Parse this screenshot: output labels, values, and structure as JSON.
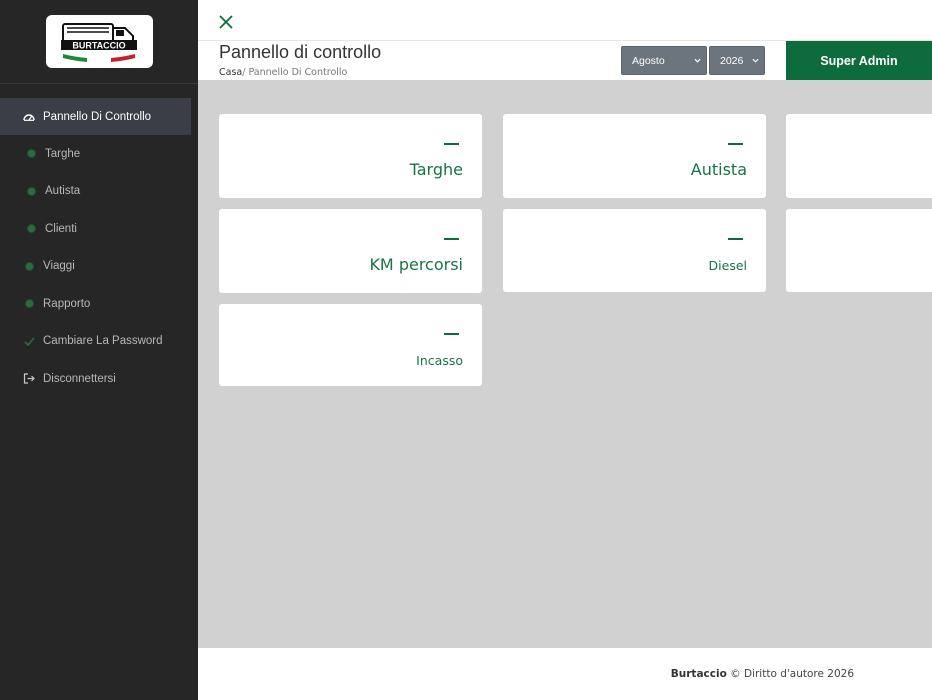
{
  "brand": {
    "logo_text": "BURTACCIO"
  },
  "sidebar": {
    "items": [
      {
        "label": "Pannello Di Controllo",
        "icon": "dashboard-icon",
        "active": true
      },
      {
        "label": "Targhe",
        "icon": "dot-icon"
      },
      {
        "label": "Autista",
        "icon": "dot-icon"
      },
      {
        "label": "Clienti",
        "icon": "dot-icon"
      },
      {
        "label": "Viaggi",
        "icon": "dot-icon"
      },
      {
        "label": "Rapporto",
        "icon": "dot-icon"
      },
      {
        "label": "Cambiare La Password",
        "icon": "check-icon"
      },
      {
        "label": "Disconnettersi",
        "icon": "logout-icon"
      }
    ]
  },
  "header": {
    "title": "Pannello di controllo",
    "breadcrumb_home": "Casa",
    "breadcrumb_current": "/ Pannello Di Controllo",
    "month_selected": "Agosto",
    "year_selected": "2026",
    "admin_label": "Super Admin"
  },
  "cards": [
    {
      "value": "—",
      "label": "Targhe"
    },
    {
      "value": "—",
      "label": "Autista"
    },
    {
      "value": "—",
      "label": "KM percorsi"
    },
    {
      "value": "—",
      "label": "Diesel"
    },
    {
      "value": "—",
      "label": "Incasso"
    }
  ],
  "footer": {
    "brand": "Burtaccio",
    "text": "© Diritto d'autore 2026"
  },
  "colors": {
    "accent": "#0e6b3c",
    "sidebar_bg": "#262626",
    "content_bg": "#d1d1d1",
    "select_bg": "#6c757d"
  }
}
